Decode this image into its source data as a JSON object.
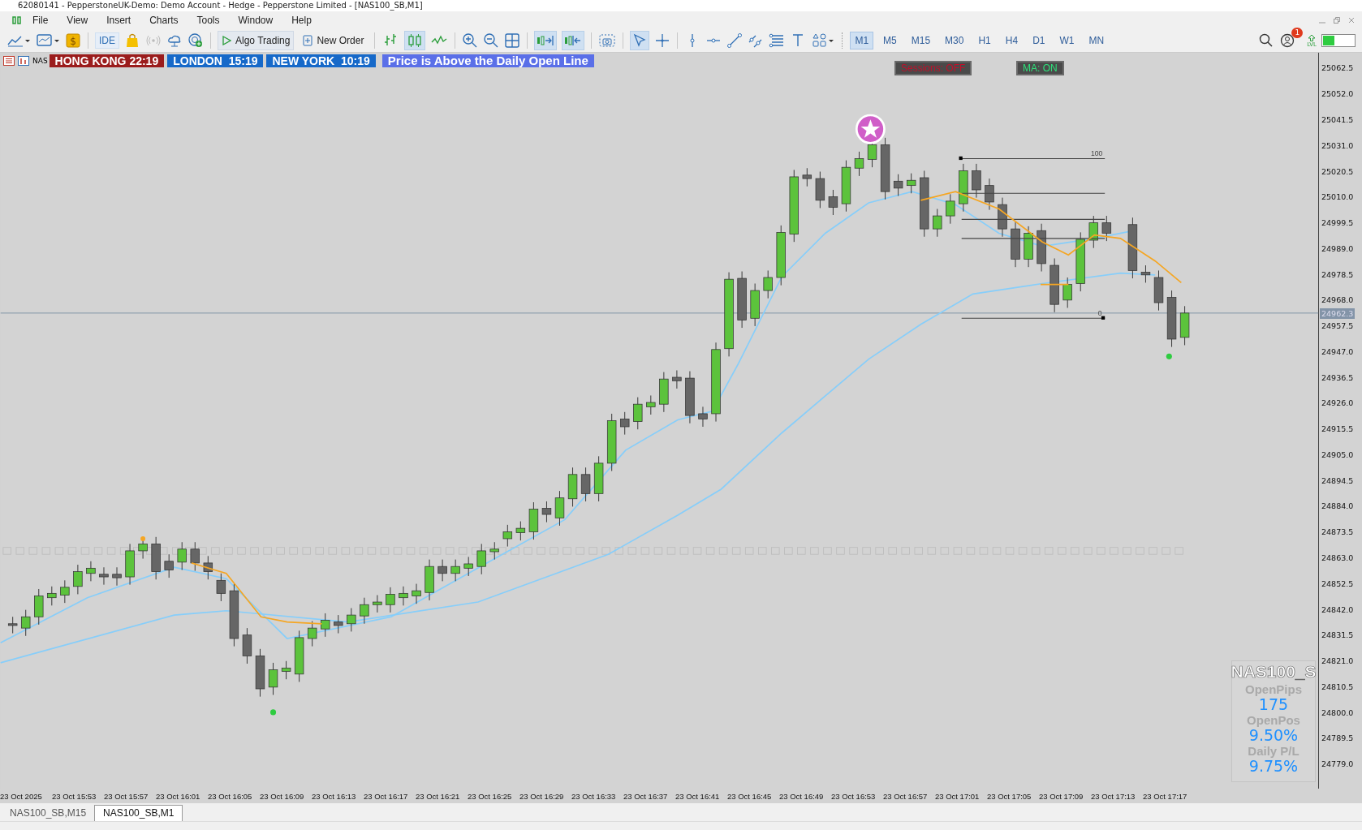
{
  "window": {
    "title": "62080141 - PepperstoneUK-Demo: Demo Account - Hedge - Pepperstone Limited - [NAS100_SB,M1]"
  },
  "menu": [
    "File",
    "View",
    "Insert",
    "Charts",
    "Tools",
    "Window",
    "Help"
  ],
  "toolbar": {
    "dollar_label": "$",
    "ide_label": "IDE",
    "algo_trading": "Algo Trading",
    "new_order": "New Order",
    "notification_count": "1",
    "lvl_label": "LVL",
    "timeframes": [
      {
        "label": "M1",
        "selected": true
      },
      {
        "label": "M5",
        "selected": false
      },
      {
        "label": "M15",
        "selected": false
      },
      {
        "label": "M30",
        "selected": false
      },
      {
        "label": "H1",
        "selected": false
      },
      {
        "label": "H4",
        "selected": false
      },
      {
        "label": "D1",
        "selected": false
      },
      {
        "label": "W1",
        "selected": false
      },
      {
        "label": "MN",
        "selected": false
      }
    ]
  },
  "chart": {
    "symbol_label": "NAS",
    "sessions": [
      {
        "label": "HONG KONG 22:19",
        "color": "#9b1c1c"
      },
      {
        "label": "LONDON  15:19",
        "color": "#1669c9"
      },
      {
        "label": "NEW YORK  10:19",
        "color": "#1669c9"
      }
    ],
    "signal": "Price is Above the Daily Open Line",
    "toggles": [
      {
        "label": "Sessions: OFF",
        "on": false
      },
      {
        "label": "MA: ON",
        "on": true
      }
    ],
    "fib_labels": [
      "100",
      "0"
    ],
    "price_axis": [
      "25062.5",
      "25052.0",
      "25041.5",
      "25031.0",
      "25020.5",
      "25010.0",
      "24999.5",
      "24989.0",
      "24978.5",
      "24968.0",
      "24957.5",
      "24947.0",
      "24936.5",
      "24926.0",
      "24915.5",
      "24905.0",
      "24894.5",
      "24884.0",
      "24873.5",
      "24863.0",
      "24852.5",
      "24842.0",
      "24831.5",
      "24821.0",
      "24810.5",
      "24800.0",
      "24789.5",
      "24779.0"
    ],
    "current_price": "24962.3",
    "time_axis": [
      "23 Oct 2025",
      "23 Oct 15:53",
      "23 Oct 15:57",
      "23 Oct 16:01",
      "23 Oct 16:05",
      "23 Oct 16:09",
      "23 Oct 16:13",
      "23 Oct 16:17",
      "23 Oct 16:21",
      "23 Oct 16:25",
      "23 Oct 16:29",
      "23 Oct 16:33",
      "23 Oct 16:37",
      "23 Oct 16:41",
      "23 Oct 16:45",
      "23 Oct 16:49",
      "23 Oct 16:53",
      "23 Oct 16:57",
      "23 Oct 17:01",
      "23 Oct 17:05",
      "23 Oct 17:09",
      "23 Oct 17:13",
      "23 Oct 17:17"
    ],
    "info_panel": {
      "symbol": "NAS100_S",
      "rows": [
        {
          "label": "OpenPips",
          "value": "175"
        },
        {
          "label": "OpenPos",
          "value": "9.50%"
        },
        {
          "label": "Daily P/L",
          "value": "9.75%"
        }
      ]
    }
  },
  "chart_tabs": [
    {
      "label": "NAS100_SB,M15",
      "selected": false
    },
    {
      "label": "NAS100_SB,M1",
      "selected": true
    }
  ]
}
